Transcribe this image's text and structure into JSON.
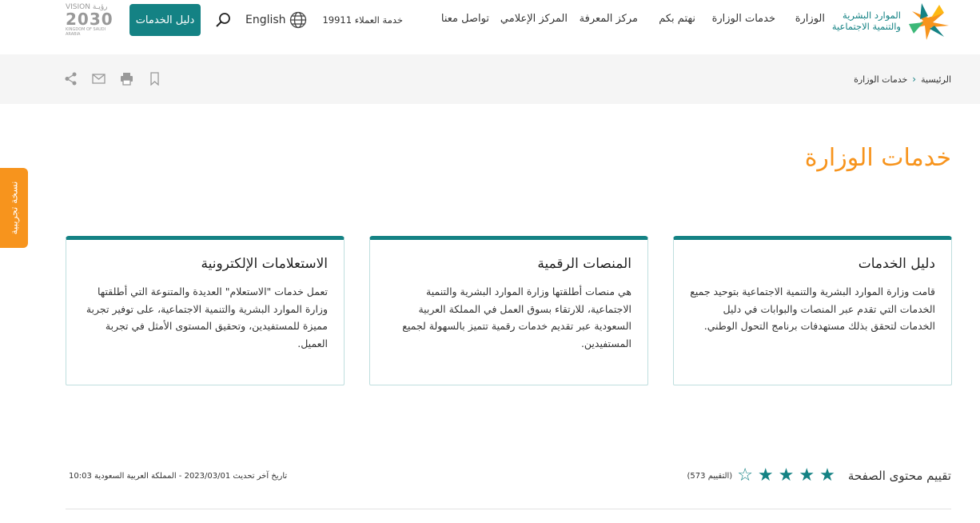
{
  "header": {
    "logo_text": [
      "الموارد البشرية",
      "والتنمية الاجتماعية"
    ],
    "nav": [
      "الوزارة",
      "خدمات الوزارة",
      "نهتم بكم",
      "مركز المعرفة",
      "المركز الإعلامي",
      "تواصل معنا"
    ],
    "customer_service": "خدمة العملاء 19911",
    "language": "English",
    "guide_button": "دليل الخدمات",
    "vision_logo": "VISION 2030 رؤية المملكة العربية السعودية KINGDOM OF SAUDI ARABIA"
  },
  "breadcrumb": {
    "home": "الرئيسية",
    "current": "خدمات الوزارة"
  },
  "side_tab": "نسخة تجريبية",
  "page_title": "خدمات الوزارة",
  "cards": [
    {
      "title": "دليل الخدمات",
      "text": "قامت وزارة الموارد البشرية والتنمية الاجتماعية بتوحيد جميع الخدمات التي تقدم عبر المنصات والبوابات في دليل الخدمات لتحقق بذلك مستهدفات برنامج التحول الوطني."
    },
    {
      "title": "المنصات الرقمية",
      "text": "هي منصات أطلقتها وزارة الموارد البشرية والتنمية الاجتماعية، للارتقاء بسوق العمل في المملكة العربية السعودية عبر تقديم خدمات رقمية تتميز بالسهولة لجميع المستفيدين."
    },
    {
      "title": "الاستعلامات الإلكترونية",
      "text": "تعمل خدمات \"الاستعلام\" العديدة والمتنوعة التي أطلقتها وزارة الموارد البشرية والتنمية الاجتماعية، على توفير تجربة مميزة للمستفيدين، وتحقيق المستوى الأمثل في تجربة العميل."
    }
  ],
  "rating": {
    "label": "تقييم محتوى الصفحة",
    "stars": 4,
    "max": 5,
    "count": "(التقييم 573)"
  },
  "last_update": "تاريخ آخر تحديث  2023/03/01  - المملكة العربية السعودية  10:03",
  "colors": {
    "primary": "#148284",
    "accent": "#f7941d"
  }
}
